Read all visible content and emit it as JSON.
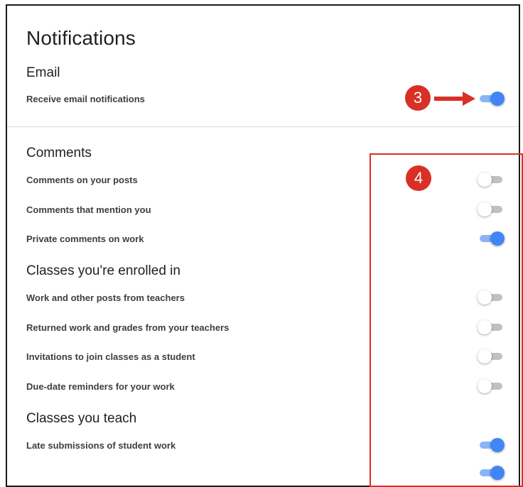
{
  "page": {
    "title": "Notifications"
  },
  "email": {
    "title": "Email",
    "rows": [
      {
        "label": "Receive email notifications",
        "on": true
      }
    ]
  },
  "comments": {
    "title": "Comments",
    "rows": [
      {
        "label": "Comments on your posts",
        "on": false
      },
      {
        "label": "Comments that mention you",
        "on": false
      },
      {
        "label": "Private comments on work",
        "on": true
      }
    ]
  },
  "enrolled": {
    "title": "Classes you're enrolled in",
    "rows": [
      {
        "label": "Work and other posts from teachers",
        "on": false
      },
      {
        "label": "Returned work and grades from your teachers",
        "on": false
      },
      {
        "label": "Invitations to join classes as a student",
        "on": false
      },
      {
        "label": "Due-date reminders for your work",
        "on": false
      }
    ]
  },
  "teach": {
    "title": "Classes you teach",
    "rows": [
      {
        "label": "Late submissions of student work",
        "on": true
      },
      {
        "label": "",
        "on": true
      }
    ]
  },
  "annotations": {
    "step3": "3",
    "step4": "4"
  },
  "colors": {
    "toggle_on_thumb": "#4285f4",
    "toggle_on_track": "#8ab4f8",
    "toggle_off_track": "#bdc1c6",
    "annotation_red": "#d93025"
  }
}
